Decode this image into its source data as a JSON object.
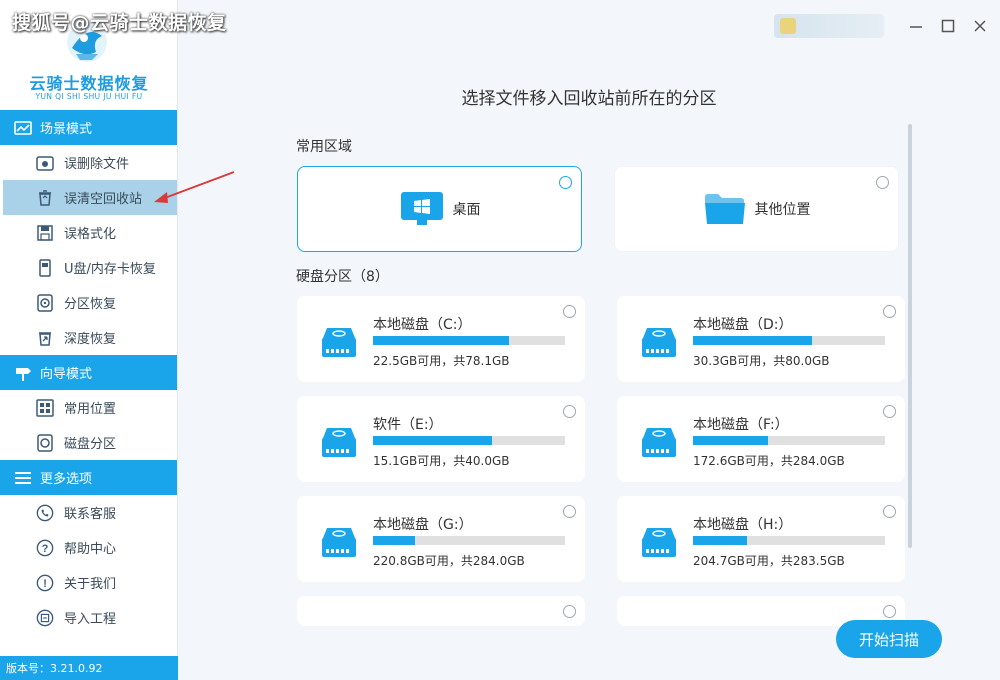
{
  "watermark": "搜狐号@云骑士数据恢复",
  "app": {
    "title": "云骑士数据恢复",
    "subtitle": "YUN QI SHI SHU JU HUI FU"
  },
  "sidebar": {
    "sections": [
      {
        "title": "场景模式",
        "icon": "scene-icon",
        "items": [
          {
            "label": "误删除文件",
            "icon": "delete-file-icon"
          },
          {
            "label": "误清空回收站",
            "icon": "recycle-bin-icon",
            "active": true
          },
          {
            "label": "误格式化",
            "icon": "format-icon"
          },
          {
            "label": "U盘/内存卡恢复",
            "icon": "usb-card-icon"
          },
          {
            "label": "分区恢复",
            "icon": "partition-icon"
          },
          {
            "label": "深度恢复",
            "icon": "deep-recovery-icon"
          }
        ]
      },
      {
        "title": "向导模式",
        "icon": "signpost-icon",
        "items": [
          {
            "label": "常用位置",
            "icon": "windows-icon"
          },
          {
            "label": "磁盘分区",
            "icon": "disk-icon"
          }
        ]
      },
      {
        "title": "更多选项",
        "icon": "menu-icon",
        "items": [
          {
            "label": "联系客服",
            "icon": "phone-icon"
          },
          {
            "label": "帮助中心",
            "icon": "question-icon"
          },
          {
            "label": "关于我们",
            "icon": "info-icon"
          },
          {
            "label": "导入工程",
            "icon": "import-icon"
          }
        ]
      }
    ],
    "version": "版本号：3.21.0.92"
  },
  "main": {
    "title": "选择文件移入回收站前所在的分区",
    "common_label": "常用区域",
    "common": [
      {
        "label": "桌面",
        "icon": "desktop-icon",
        "selected": true
      },
      {
        "label": "其他位置",
        "icon": "folder-icon",
        "selected": false
      }
    ],
    "disk_label": "硬盘分区（8）",
    "disks": [
      {
        "name": "本地磁盘（C:）",
        "size": "22.5GB可用，共78.1GB",
        "used_fraction": 0.71
      },
      {
        "name": "本地磁盘（D:）",
        "size": "30.3GB可用，共80.0GB",
        "used_fraction": 0.62
      },
      {
        "name": "软件（E:）",
        "size": "15.1GB可用，共40.0GB",
        "used_fraction": 0.62
      },
      {
        "name": "本地磁盘（F:）",
        "size": "172.6GB可用，共284.0GB",
        "used_fraction": 0.39
      },
      {
        "name": "本地磁盘（G:）",
        "size": "220.8GB可用，共284.0GB",
        "used_fraction": 0.22
      },
      {
        "name": "本地磁盘（H:）",
        "size": "204.7GB可用，共283.5GB",
        "used_fraction": 0.28
      }
    ],
    "start_button": "开始扫描"
  },
  "colors": {
    "accent": "#1aa5ea",
    "active_bg": "#a9d2e8",
    "annotation": "#d93a3a"
  }
}
